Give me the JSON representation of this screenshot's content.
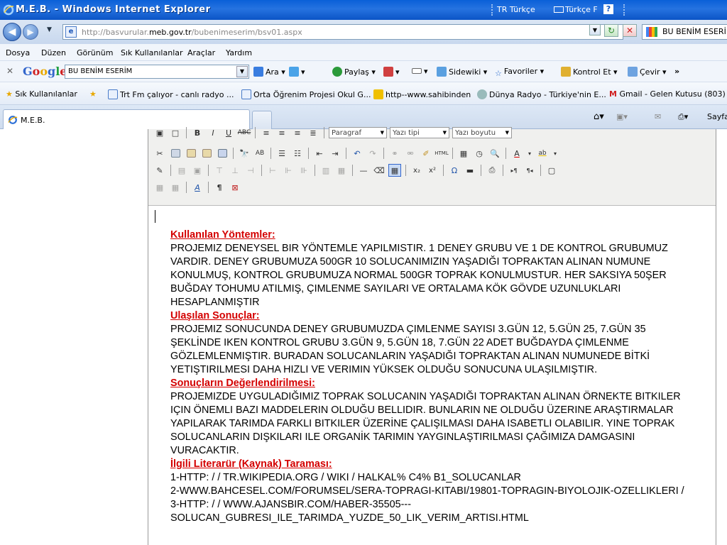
{
  "window": {
    "title": "M.E.B. - Windows Internet Explorer",
    "language": "TR Türkçe",
    "keyboard": "Türkçe F",
    "help": "?"
  },
  "addressbar": {
    "url_prefix": "http://basvurular.",
    "url_domain": "meb.gov.tr",
    "url_path": "/bubenimeserim/bsv01.aspx",
    "search_text": "BU BENİM ESERİM"
  },
  "menu": [
    "Dosya",
    "Düzen",
    "Görünüm",
    "Sık Kullanılanlar",
    "Araçlar",
    "Yardım"
  ],
  "google_toolbar": {
    "brand": "Google",
    "query": "BU BENİM ESERİM",
    "items": [
      "Ara",
      "Paylaş",
      "Sidewiki",
      "Favoriler",
      "Kontrol Et",
      "Çevir",
      "»"
    ]
  },
  "favorites": {
    "label": "Sık Kullanılanlar",
    "items": [
      "Trt Fm çalıyor - canlı radyo ...",
      "Orta Öğrenim Projesi Okul G...",
      "http--www.sahibinden",
      "Dünya Radyo - Türkiye'nin E...",
      "Gmail - Gelen Kutusu (803) -..."
    ]
  },
  "tab": {
    "label": "M.E.B."
  },
  "command_bar": {
    "page_label": "Sayfa"
  },
  "editor": {
    "format_select": "Paragraf",
    "font_select": "Yazı tipi",
    "size_select": "Yazı boyutu",
    "sections": [
      {
        "heading": "Kullanılan Yöntemler:",
        "body": " PROJEMIZ DENEYSEL BIR YÖNTEMLE YAPILMISTIR. 1 DENEY GRUBU VE 1 DE KONTROL GRUBUMUZ VARDIR. DENEY GRUBUMUZA 500GR 10 SOLUCANIMIZIN YAŞADIĞI TOPRAKTAN ALINAN NUMUNE KONULMUŞ, KONTROL GRUBUMUZA NORMAL 500GR TOPRAK KONULMUSTUR. HER SAKSIYA 50ŞER BUĞDAY TOHUMU ATILMIŞ, ÇIMLENME SAYILARI VE ORTALAMA KÖK GÖVDE UZUNLUKLARI HESAPLANMIŞTIR"
      },
      {
        "heading": "Ulaşılan Sonuçlar:",
        "body": "PROJEMIZ SONUCUNDA DENEY GRUBUMUZDA ÇIMLENME SAYISI 3.GÜN 12, 5.GÜN 25, 7.GÜN 35 ŞEKLİNDE IKEN KONTROL GRUBU 3.GÜN 9, 5.GÜN 18, 7.GÜN 22 ADET BUĞDAYDA ÇIMLENME GÖZLEMLENMIŞTIR. BURADAN SOLUCANLARIN YAŞADIĞI TOPRAKTAN ALINAN NUMUNEDE BİTKİ YETIŞTIRILMESI DAHA HIZLI VE VERIMIN YÜKSEK OLDUĞU SONUCUNA ULAŞILMIŞTIR."
      },
      {
        "heading": "Sonuçların Değerlendirilmesi:",
        "body": " PROJEMIZDE UYGULADIĞIMIZ TOPRAK SOLUCANIN YAŞADIĞI TOPRAKTAN ALINAN ÖRNEKTE BITKILER IÇIN ÖNEMLI BAZI MADDELERIN OLDUĞU BELLIDIR. BUNLARIN NE OLDUĞU ÜZERINE ARAŞTIRMALAR YAPILARAK TARIMDA FARKLI BITKILER ÜZERİNE ÇALIŞILMASI DAHA ISABETLI OLABILIR. YINE TOPRAK SOLUCANLARIN DIŞKILARI ILE ORGANİK TARIMIN YAYGINLAŞTIRILMASI ÇAĞIMIZA DAMGASINI VURACAKTIR."
      },
      {
        "heading": "İlgili Literarür (Kaynak) Taraması:",
        "lines": [
          "1-HTTP: / / TR.WIKIPEDIA.ORG / WIKI / HALKAL% C4% B1_SOLUCANLAR",
          "2-WWW.BAHCESEL.COM/FORUMSEL/SERA-TOPRAGI-KITABI/19801-TOPRAGIN-BIYOLOJIK-OZELLIKLERI /",
          "3-HTTP: / / WWW.AJANSBIR.COM/HABER-35505---SOLUCAN_GUBRESI_ILE_TARIMDA_YUZDE_50_LIK_VERIM_ARTISI.HTML"
        ]
      }
    ]
  }
}
